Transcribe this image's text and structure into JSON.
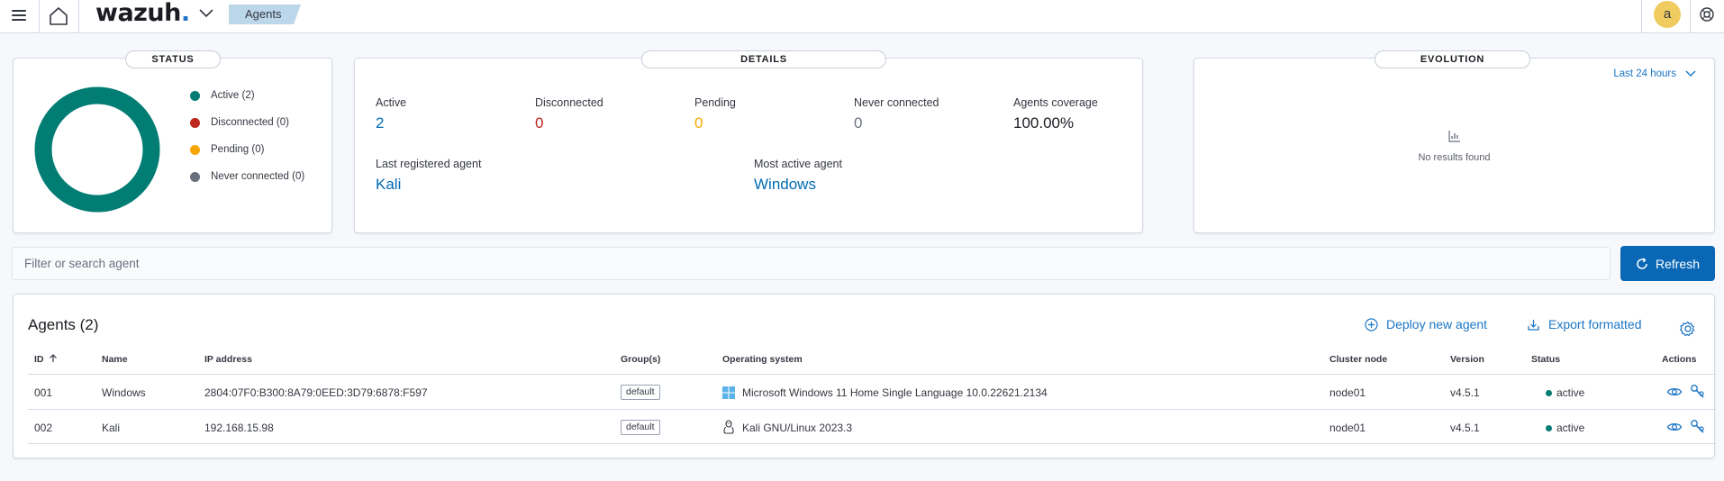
{
  "header": {
    "logo_text": "wazuh",
    "logo_dot": ".",
    "breadcrumb": "Agents",
    "avatar_initial": "a"
  },
  "status_panel": {
    "title": "STATUS",
    "legend": [
      {
        "label": "Active (2)",
        "color": "#017d73"
      },
      {
        "label": "Disconnected (0)",
        "color": "#bd271e"
      },
      {
        "label": "Pending (0)",
        "color": "#f5a700"
      },
      {
        "label": "Never connected (0)",
        "color": "#69707d"
      }
    ],
    "donut": {
      "active": 2,
      "disconnected": 0,
      "pending": 0,
      "never_connected": 0,
      "color": "#017d73"
    }
  },
  "details_panel": {
    "title": "DETAILS",
    "stats": [
      {
        "label": "Active",
        "value": "2",
        "color": "#006bb4"
      },
      {
        "label": "Disconnected",
        "value": "0",
        "color": "#bd271e"
      },
      {
        "label": "Pending",
        "value": "0",
        "color": "#f5a700"
      },
      {
        "label": "Never connected",
        "value": "0",
        "color": "#69707d"
      },
      {
        "label": "Agents coverage",
        "value": "100.00%",
        "color": "#1a1c21"
      }
    ],
    "last_registered": {
      "label": "Last registered agent",
      "value": "Kali"
    },
    "most_active": {
      "label": "Most active agent",
      "value": "Windows"
    }
  },
  "evolution_panel": {
    "title": "EVOLUTION",
    "time_filter": "Last 24 hours",
    "empty_text": "No results found"
  },
  "search": {
    "placeholder": "Filter or search agent"
  },
  "refresh_label": "Refresh",
  "agents_table": {
    "title": "Agents (2)",
    "deploy_label": "Deploy new agent",
    "export_label": "Export formatted",
    "columns": [
      "ID",
      "Name",
      "IP address",
      "Group(s)",
      "Operating system",
      "Cluster node",
      "Version",
      "Status",
      "Actions"
    ],
    "rows": [
      {
        "id": "001",
        "name": "Windows",
        "ip": "2804:07F0:B300:8A79:0EED:3D79:6878:F597",
        "group": "default",
        "os": "Microsoft Windows 11 Home Single Language 10.0.22621.2134",
        "os_icon": "windows-icon",
        "node": "node01",
        "version": "v4.5.1",
        "status": "active"
      },
      {
        "id": "002",
        "name": "Kali",
        "ip": "192.168.15.98",
        "group": "default",
        "os": "Kali GNU/Linux 2023.3",
        "os_icon": "linux-tux-icon",
        "node": "node01",
        "version": "v4.5.1",
        "status": "active"
      }
    ]
  }
}
